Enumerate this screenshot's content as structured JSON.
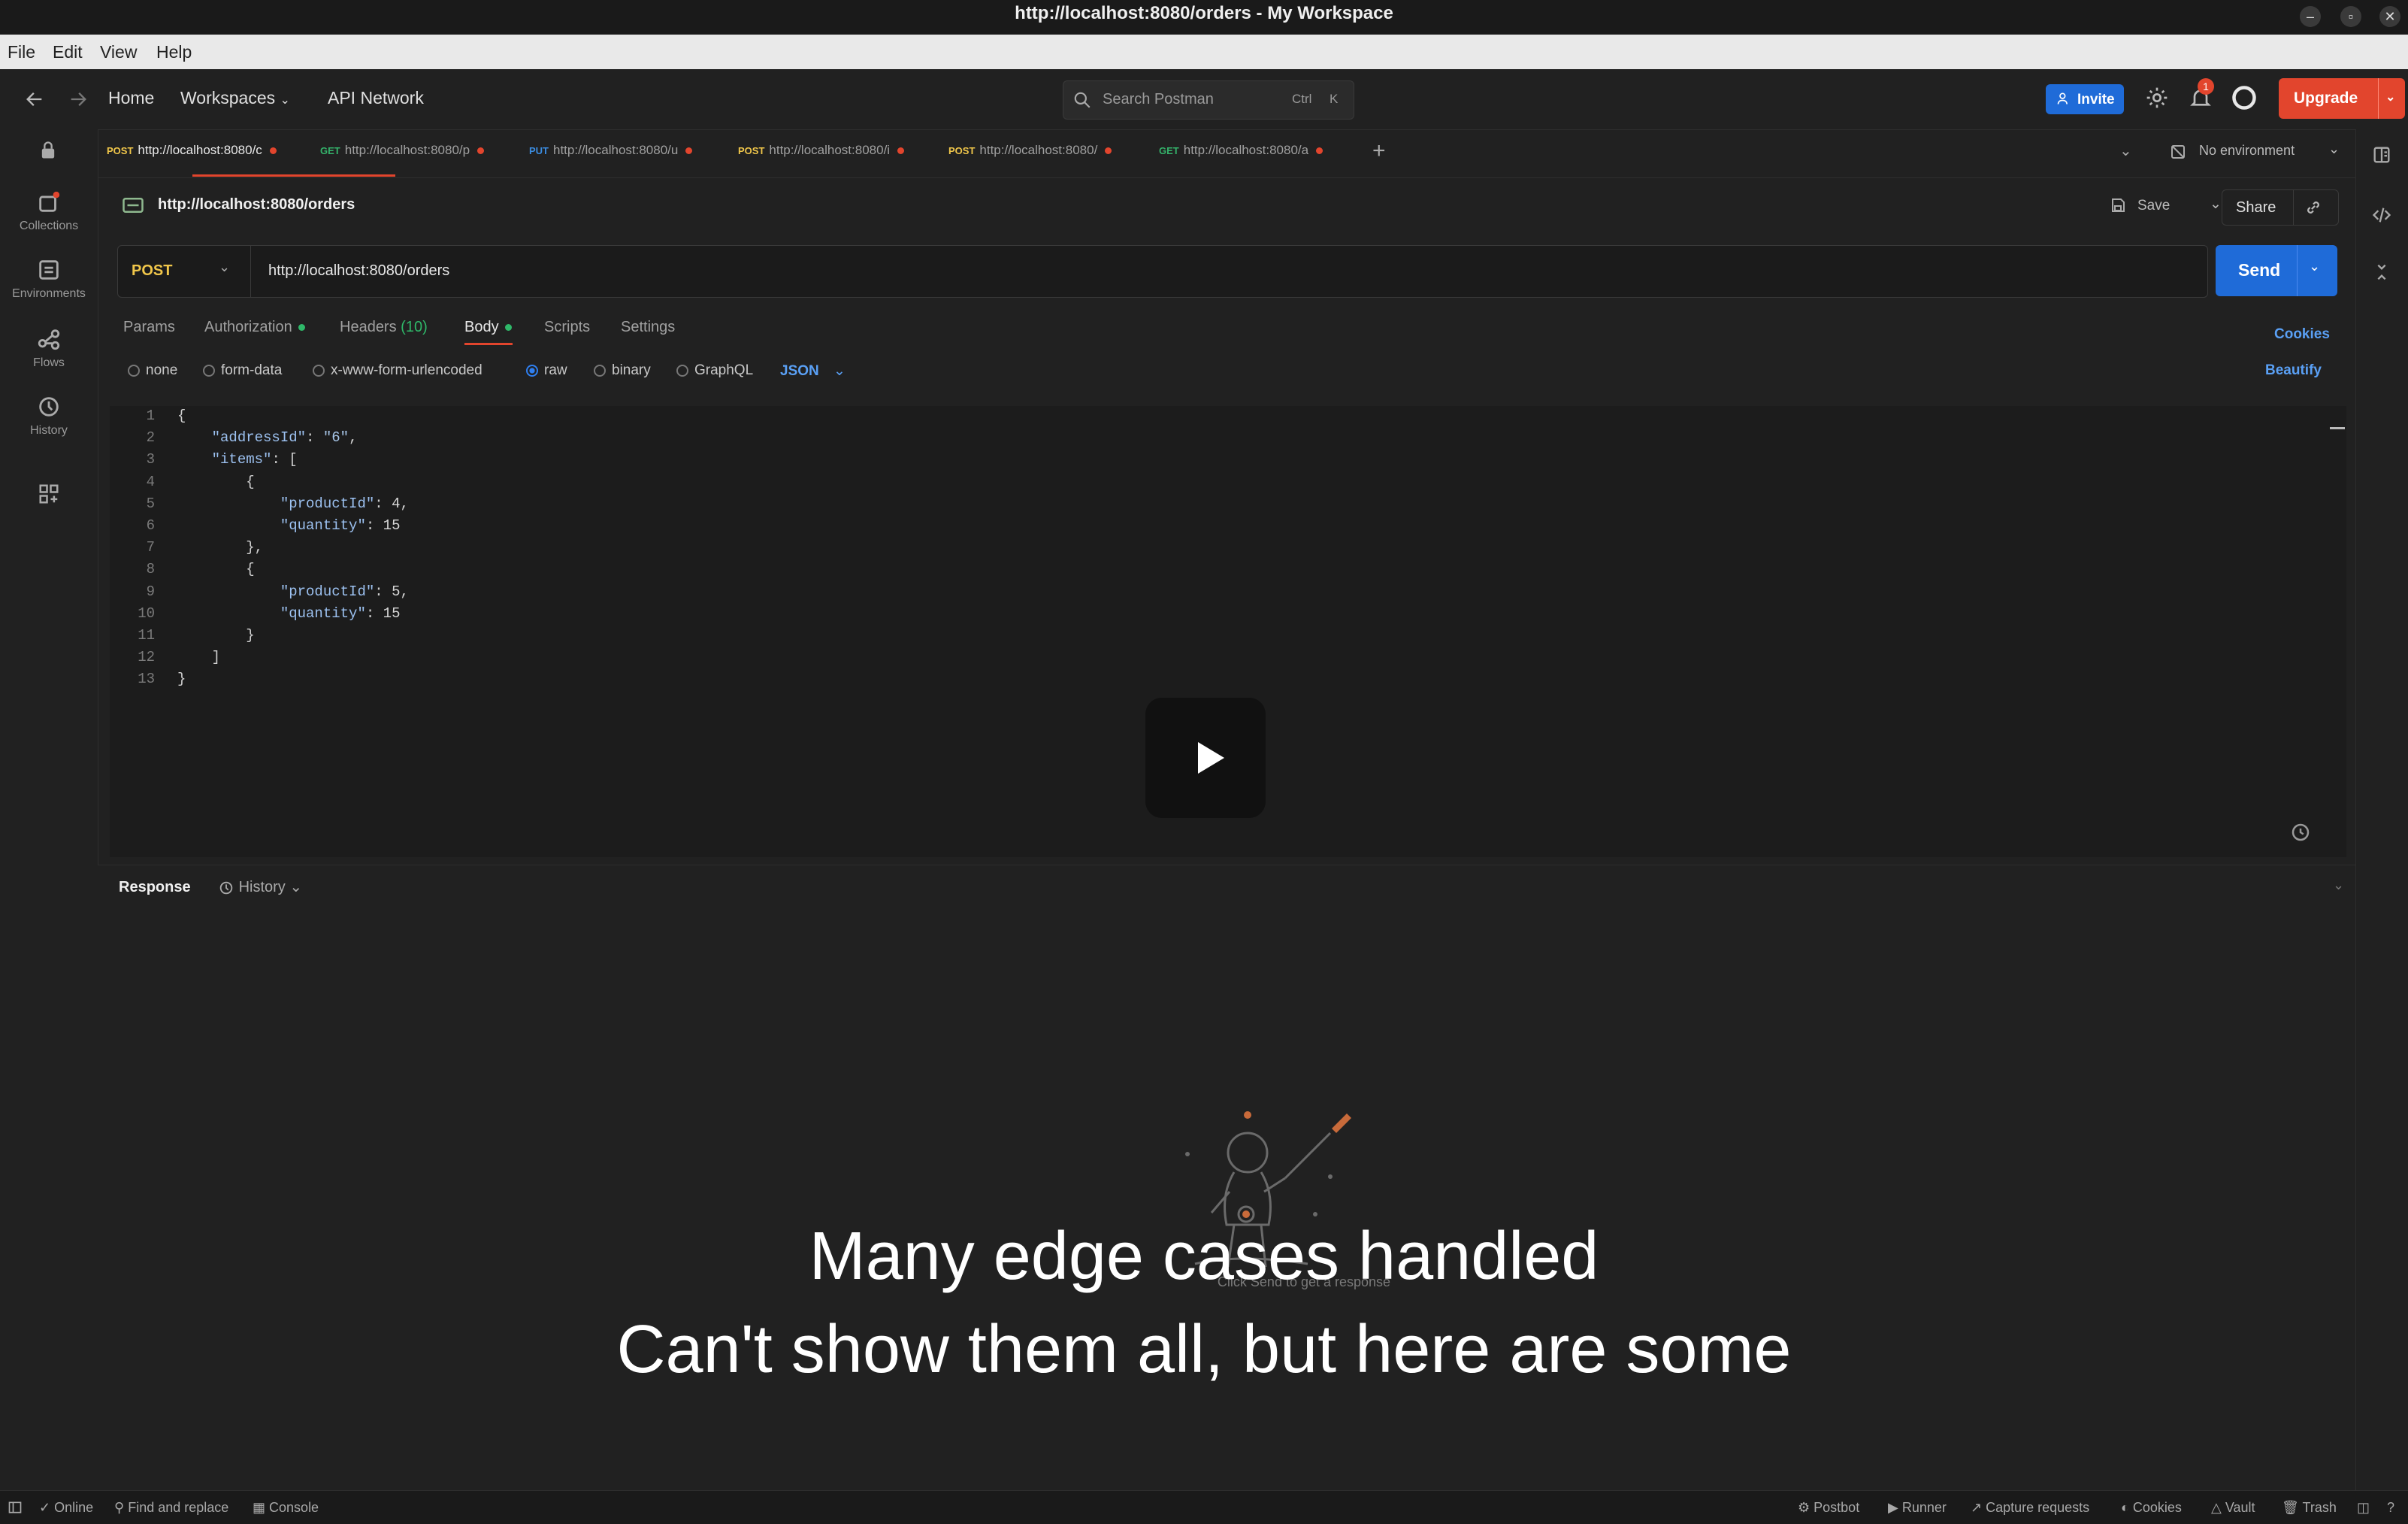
{
  "window": {
    "title": "http://localhost:8080/orders - My Workspace"
  },
  "menu": [
    "File",
    "Edit",
    "View",
    "Help"
  ],
  "header": {
    "home": "Home",
    "workspaces": "Workspaces",
    "api_network": "API Network",
    "search_placeholder": "Search Postman",
    "search_shortcut_ctrl": "Ctrl",
    "search_shortcut_key": "K",
    "invite": "Invite",
    "notification_count": "1",
    "upgrade": "Upgrade"
  },
  "rail": [
    {
      "label": "Collections",
      "icon": "collections-icon"
    },
    {
      "label": "Environments",
      "icon": "environments-icon"
    },
    {
      "label": "Flows",
      "icon": "flows-icon"
    },
    {
      "label": "History",
      "icon": "history-icon"
    }
  ],
  "tabs": [
    {
      "method": "POST",
      "url": "http://localhost:8080/c",
      "method_color": "#f0c64a",
      "active": true
    },
    {
      "method": "GET",
      "url": "http://localhost:8080/p",
      "method_color": "#34b26a"
    },
    {
      "method": "PUT",
      "url": "http://localhost:8080/u",
      "method_color": "#3b8ce0"
    },
    {
      "method": "POST",
      "url": "http://localhost:8080/i",
      "method_color": "#f0c64a"
    },
    {
      "method": "POST",
      "url": "http://localhost:8080/",
      "method_color": "#f0c64a"
    },
    {
      "method": "GET",
      "url": "http://localhost:8080/a",
      "method_color": "#34b26a"
    }
  ],
  "environment": "No environment",
  "request": {
    "title": "http://localhost:8080/orders",
    "save": "Save",
    "share": "Share",
    "method": "POST",
    "url": "http://localhost:8080/orders",
    "send": "Send",
    "tabs": {
      "params": "Params",
      "authorization": "Authorization",
      "headers": "Headers",
      "headers_count": "(10)",
      "body": "Body",
      "scripts": "Scripts",
      "settings": "Settings"
    },
    "cookies": "Cookies",
    "beautify": "Beautify",
    "body_types": [
      "none",
      "form-data",
      "x-www-form-urlencoded",
      "raw",
      "binary",
      "GraphQL"
    ],
    "selected_body_type": "raw",
    "format": "JSON",
    "code_lines": [
      "1",
      "2",
      "3",
      "4",
      "5",
      "6",
      "7",
      "8",
      "9",
      "10",
      "11",
      "12",
      "13"
    ]
  },
  "response": {
    "label": "Response",
    "history": "History",
    "hint": "Click Send to get a response"
  },
  "caption": {
    "line1": "Many edge cases handled",
    "line2": "Can't show them all, but here are some"
  },
  "statusbar": {
    "online": "Online",
    "find_replace": "Find and replace",
    "console": "Console",
    "postbot": "Postbot",
    "runner": "Runner",
    "capture": "Capture requests",
    "cookies": "Cookies",
    "vault": "Vault",
    "trash": "Trash"
  },
  "colors": {
    "accent_blue": "#1f6bd8",
    "upgrade_orange": "#e2452d",
    "post_yellow": "#f0c64a",
    "get_green": "#34b26a",
    "put_blue": "#3b8ce0"
  }
}
